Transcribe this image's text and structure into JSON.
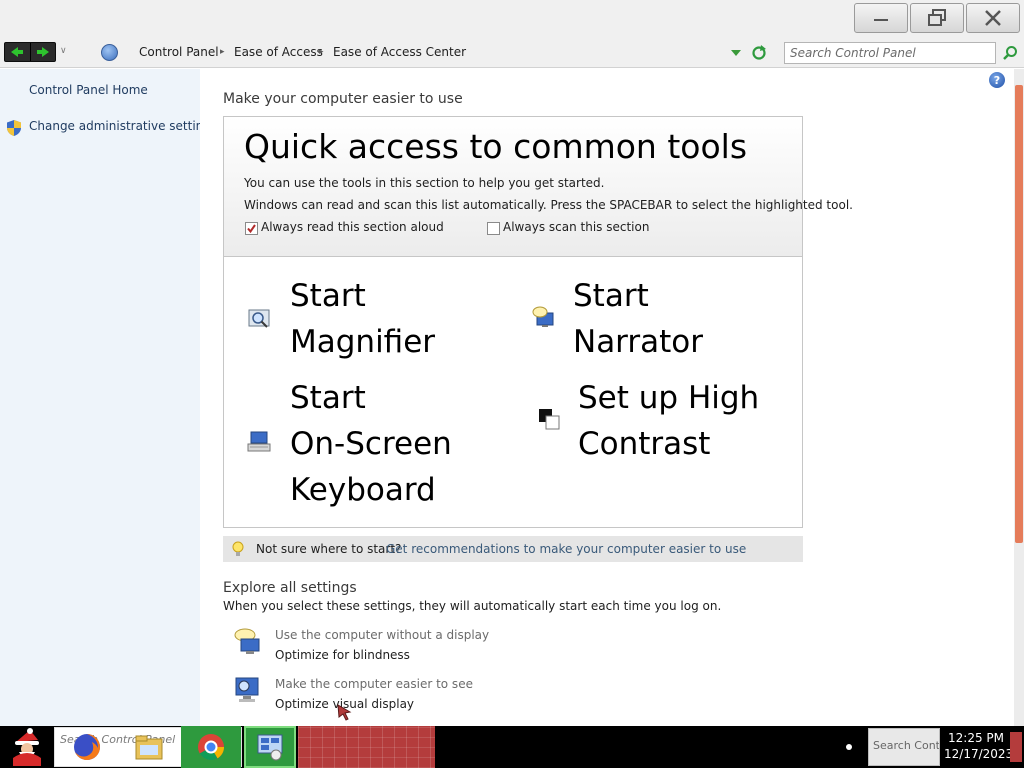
{
  "window": {
    "controls": {
      "minimize": "minimize",
      "restore": "restore",
      "close": "close"
    }
  },
  "address": {
    "breadcrumbs": [
      "Control Panel",
      "Ease of Access",
      "Ease of Access Center"
    ],
    "search_placeholder": "Search Control Panel"
  },
  "sidebar": {
    "items": [
      {
        "label": "Control Panel Home"
      },
      {
        "label": "Change administrative settings",
        "icon": "shield-icon"
      }
    ]
  },
  "main": {
    "heading": "Make your computer easier to use",
    "quick_access": {
      "title": "Quick access to common tools",
      "line1": "You can use the tools in this section to help you get started.",
      "line2": "Windows can read and scan this list automatically.  Press the SPACEBAR to select the highlighted tool.",
      "read_aloud": {
        "label": "Always read this section aloud",
        "checked": true
      },
      "scan": {
        "label": "Always scan this section",
        "checked": false
      },
      "tools": {
        "magnifier": {
          "line1": "Start",
          "line2": "Magnifier",
          "icon": "magnifier-icon"
        },
        "narrator": {
          "line1": "Start",
          "line2": "Narrator",
          "icon": "narrator-icon"
        },
        "keyboard": {
          "line1": "Start",
          "line2": "On-Screen",
          "line3": "Keyboard",
          "icon": "keyboard-icon"
        },
        "contrast": {
          "line1": "Set up High",
          "line2": "Contrast",
          "icon": "contrast-icon"
        }
      }
    },
    "tip": {
      "text": "Not sure where to start?",
      "link": "Get recommendations to make your computer easier to use"
    },
    "explore": {
      "title": "Explore all settings",
      "subtitle": "When you select these settings, they will automatically start each time you log on.",
      "settings": [
        {
          "title": "Use the computer without a display",
          "link": "Optimize for blindness",
          "icon": "display-speech-icon"
        },
        {
          "title": "Make the computer easier to see",
          "link": "Optimize visual display",
          "icon": "monitor-icon"
        }
      ]
    }
  },
  "taskbar": {
    "search_text": "Search Control Panel",
    "tray_text": "Search Contr",
    "time": "12:25 PM",
    "date": "12/17/2023"
  },
  "colors": {
    "sidebar_bg": "#eef4fa",
    "scroll_thumb": "#e57c5a",
    "taskbar_bg": "#000000",
    "taskbar_red": "#b43c3c"
  }
}
